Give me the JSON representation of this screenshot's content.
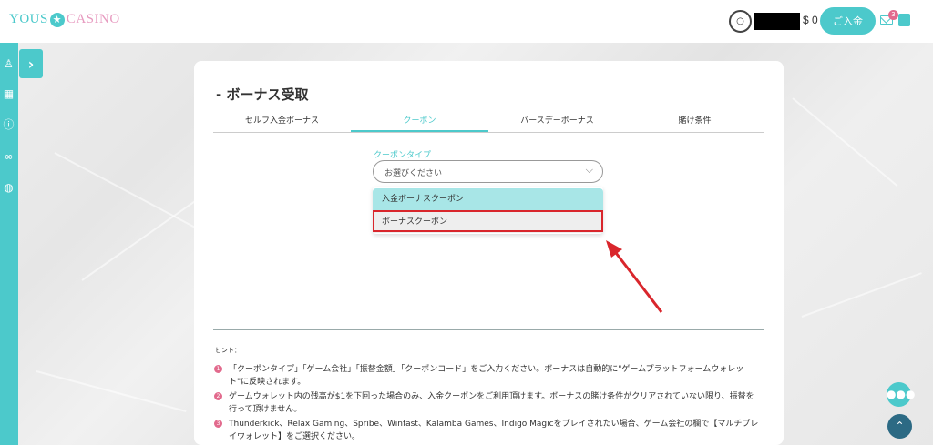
{
  "header": {
    "logo_left": "YOUS",
    "logo_star": "★",
    "logo_right": "CASINO",
    "avatar_glyph": "○",
    "balance": "$ 0",
    "deposit_label": "ご入金",
    "mail_badge": "3",
    "icons": [
      "user-avatar-icon",
      "mail-icon",
      "logout-icon"
    ]
  },
  "sidebar": {
    "toggle_glyph": "›",
    "icons": [
      "medal-icon",
      "grid-icon",
      "info-icon",
      "link-icon",
      "globe-icon"
    ]
  },
  "main": {
    "title": "ボーナス受取",
    "title_dash": "-",
    "tabs": [
      {
        "label": "セルフ入金ボーナス",
        "active": false
      },
      {
        "label": "クーポン",
        "active": true
      },
      {
        "label": "バースデーボーナス",
        "active": false
      },
      {
        "label": "賭け条件",
        "active": false
      }
    ],
    "coupon_type_label": "クーポンタイプ",
    "select_placeholder": "お選びください",
    "dropdown_options": [
      "入金ボーナスクーポン",
      "ボーナスクーポン"
    ],
    "hint_title": "ヒント：",
    "hints": [
      {
        "num": "1",
        "text": "「クーポンタイプ」「ゲーム会社」「振替金額」「クーポンコード」をご入力ください。ボーナスは自動的に\"ゲームプラットフォームウォレット\"に反映されます。"
      },
      {
        "num": "2",
        "text": "ゲームウォレット内の残高が$1を下回った場合のみ、入金クーポンをご利用頂けます。ボーナスの賭け条件がクリアされていない限り、振替を行って頂けません。"
      },
      {
        "num": "3",
        "text": "Thunderkick、Relax Gaming、Spribe、Winfast、Kalamba Games、Indigo Magicをプレイされたい場合、ゲーム会社の欄で【マルチプレイウォレット】をご選択ください。"
      }
    ]
  },
  "colors": {
    "accent": "#4cc9cb",
    "highlight_red": "#d9262c",
    "badge_pink": "#e26a8d"
  }
}
